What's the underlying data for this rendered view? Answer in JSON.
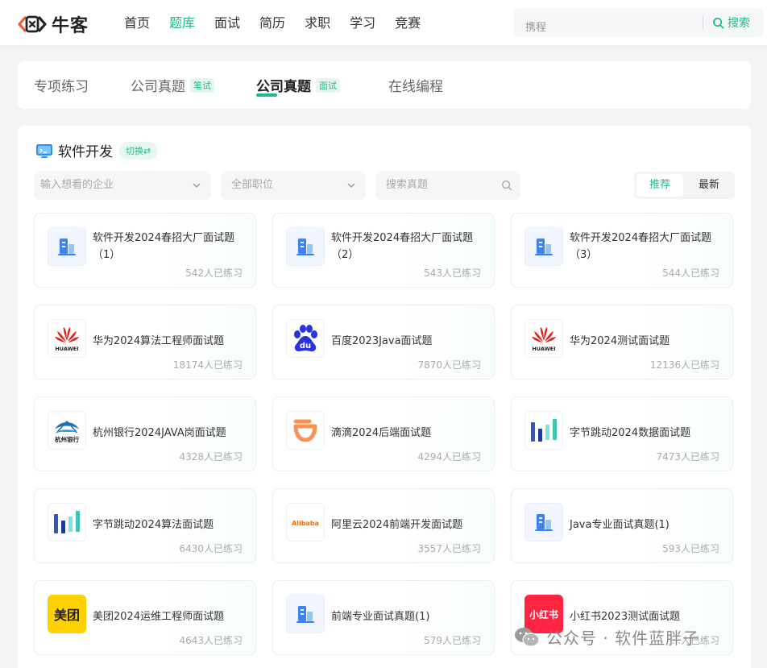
{
  "brand": {
    "name": "牛客"
  },
  "nav": [
    {
      "label": "首页",
      "active": false
    },
    {
      "label": "题库",
      "active": true
    },
    {
      "label": "面试",
      "active": false
    },
    {
      "label": "简历",
      "active": false
    },
    {
      "label": "求职",
      "active": false
    },
    {
      "label": "学习",
      "active": false
    },
    {
      "label": "竞赛",
      "active": false
    }
  ],
  "search": {
    "placeholder": "携程",
    "button_label": "搜索"
  },
  "tabs": [
    {
      "label": "专项练习",
      "badge": ""
    },
    {
      "label": "公司真题",
      "badge": "笔试"
    },
    {
      "label": "公司真题",
      "badge": "面试",
      "active": true
    },
    {
      "label": "在线编程",
      "badge": ""
    }
  ],
  "section": {
    "title": "软件开发",
    "switch_label": "切换⇄"
  },
  "filters": {
    "company_placeholder": "输入想看的企业",
    "position_placeholder": "全部职位",
    "question_placeholder": "搜索真题"
  },
  "sort": {
    "options": [
      "推荐",
      "最新"
    ],
    "selected": "推荐"
  },
  "colors": {
    "accent": "#1fb88a",
    "huawei_red": "#e2231a",
    "baidu_blue": "#2932e1",
    "didi_orange": "#fc9153",
    "meituan_yellow": "#ffd100",
    "xhs_red": "#ff2442"
  },
  "cards": [
    {
      "title": "软件开发2024春招大厂面试题（1）",
      "count": "542人已练习",
      "logo": "building-icon"
    },
    {
      "title": "软件开发2024春招大厂面试题（2）",
      "count": "543人已练习",
      "logo": "building-icon"
    },
    {
      "title": "软件开发2024春招大厂面试题（3）",
      "count": "544人已练习",
      "logo": "building-icon"
    },
    {
      "title": "华为2024算法工程师面试题",
      "count": "18174人已练习",
      "logo": "huawei-logo",
      "logo_text": "HUAWEI"
    },
    {
      "title": "百度2023Java面试题",
      "count": "7870人已练习",
      "logo": "baidu-logo",
      "logo_text": "du"
    },
    {
      "title": "华为2024测试面试题",
      "count": "12136人已练习",
      "logo": "huawei-logo",
      "logo_text": "HUAWEI"
    },
    {
      "title": "杭州银行2024JAVA岗面试题",
      "count": "4328人已练习",
      "logo": "hangzhou-bank-logo",
      "logo_text": "杭州银行"
    },
    {
      "title": "滴滴2024后端面试题",
      "count": "4294人已练习",
      "logo": "didi-logo"
    },
    {
      "title": "字节跳动2024数据面试题",
      "count": "7473人已练习",
      "logo": "bytedance-logo"
    },
    {
      "title": "字节跳动2024算法面试题",
      "count": "6430人已练习",
      "logo": "bytedance-logo"
    },
    {
      "title": "阿里云2024前端开发面试题",
      "count": "3557人已练习",
      "logo": "alibaba-logo",
      "logo_text": "Alibaba"
    },
    {
      "title": "Java专业面试真题(1)",
      "count": "593人已练习",
      "logo": "building-icon"
    },
    {
      "title": "美团2024运维工程师面试题",
      "count": "4643人已练习",
      "logo": "meituan-logo",
      "logo_text": "美团"
    },
    {
      "title": "前端专业面试真题(1)",
      "count": "579人已练习",
      "logo": "building-icon"
    },
    {
      "title": "小红书2023测试面试题",
      "count": "...人已练习",
      "logo": "xiaohongshu-logo",
      "logo_text": "小红书"
    }
  ],
  "watermark": {
    "text": "公众号 · 软件蓝胖子"
  }
}
